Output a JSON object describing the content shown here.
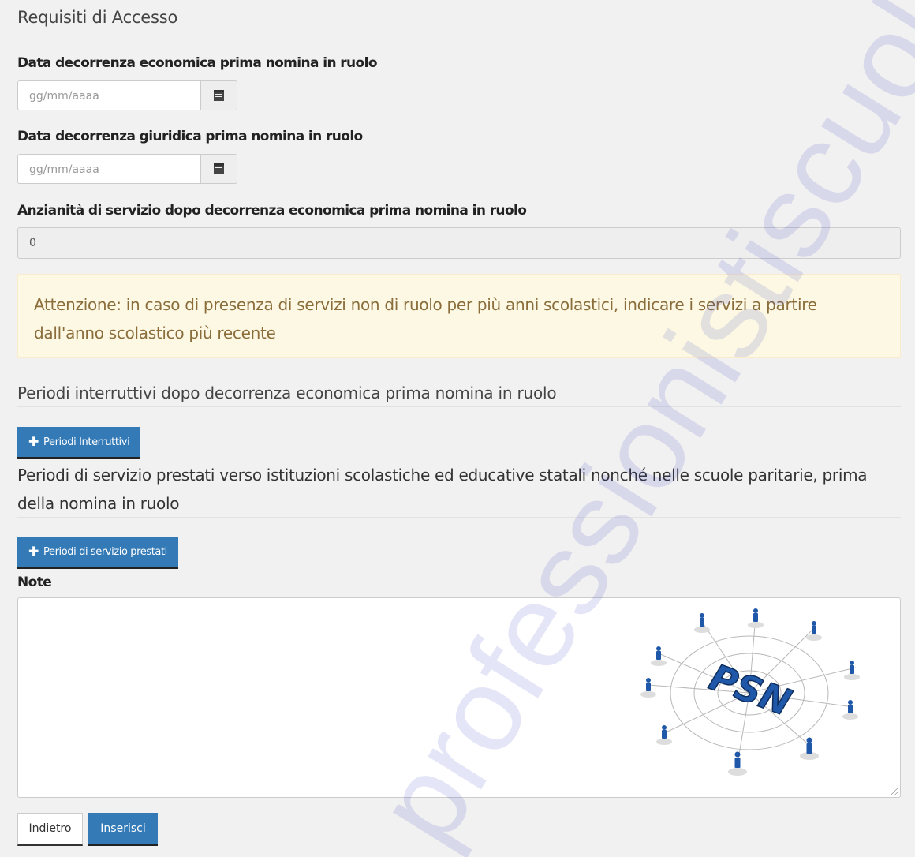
{
  "section": {
    "access_title": "Requisiti di Accesso",
    "interruptive_title": "Periodi interruttivi dopo decorrenza economica prima nomina in ruolo",
    "service_title": "Periodi di servizio prestati verso istituzioni scolastiche ed educative statali nonché nelle scuole paritarie, prima della nomina in ruolo"
  },
  "fields": {
    "economic_date": {
      "label": "Data decorrenza economica prima nomina in ruolo",
      "placeholder": "gg/mm/aaaa",
      "value": ""
    },
    "legal_date": {
      "label": "Data decorrenza giuridica prima nomina in ruolo",
      "placeholder": "gg/mm/aaaa",
      "value": ""
    },
    "seniority": {
      "label": "Anzianità di servizio dopo decorrenza economica prima nomina in ruolo",
      "value": "0"
    },
    "notes": {
      "label": "Note",
      "value": ""
    }
  },
  "alert": {
    "text": "Attenzione: in caso di presenza di servizi non di ruolo per più anni scolastici, indicare i servizi a partire dall'anno scolastico più recente"
  },
  "buttons": {
    "add_interruptive": "Periodi Interruttivi",
    "add_service": "Periodi di servizio prestati",
    "back": "Indietro",
    "submit": "Inserisci"
  },
  "logo": {
    "text": "PSN"
  },
  "watermark": {
    "text": "professionistiscuola.it"
  },
  "colors": {
    "primary": "#337ab7",
    "alert_bg": "#fcf8e3",
    "alert_text": "#8a6d3b",
    "page_bg": "#f1f1f1",
    "watermark": "#3333cc"
  },
  "icons": {
    "calendar": "calendar-icon",
    "plus": "plus-icon"
  }
}
